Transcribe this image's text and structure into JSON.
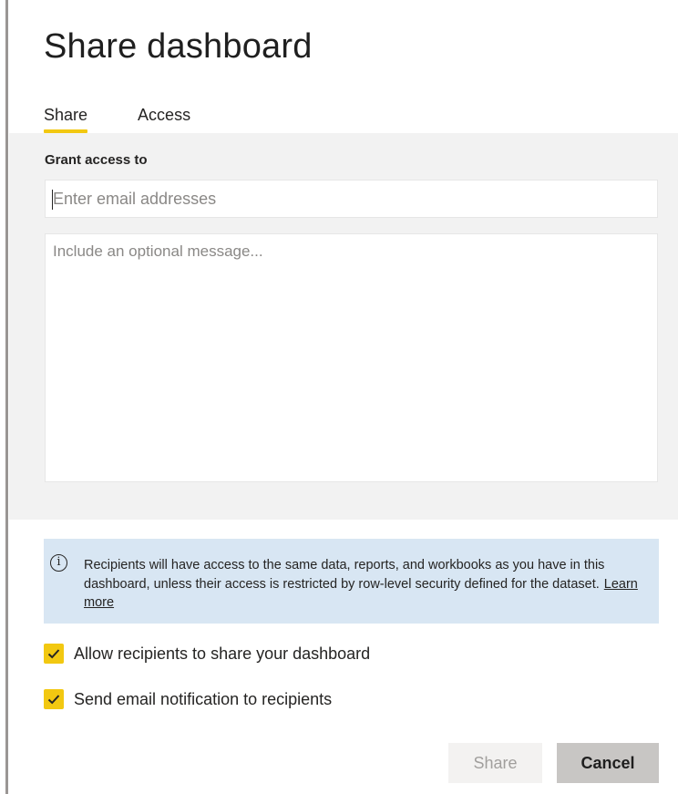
{
  "dialog": {
    "title": "Share dashboard"
  },
  "tabs": [
    {
      "label": "Share",
      "active": true
    },
    {
      "label": "Access",
      "active": false
    }
  ],
  "grant": {
    "label": "Grant access to",
    "email_placeholder": "Enter email addresses",
    "email_value": "",
    "message_placeholder": "Include an optional message...",
    "message_value": ""
  },
  "info": {
    "icon": "info-icon",
    "text": "Recipients will have access to the same data, reports, and workbooks as you have in this dashboard, unless their access is restricted by row-level security defined for the dataset.",
    "link": "Learn more"
  },
  "options": [
    {
      "label": "Allow recipients to share your dashboard",
      "checked": true
    },
    {
      "label": "Send email notification to recipients",
      "checked": true
    }
  ],
  "buttons": {
    "share": "Share",
    "cancel": "Cancel"
  },
  "colors": {
    "accent": "#f2c811",
    "info_bg": "#d8e6f3",
    "panel_bg": "#f2f2f2"
  }
}
